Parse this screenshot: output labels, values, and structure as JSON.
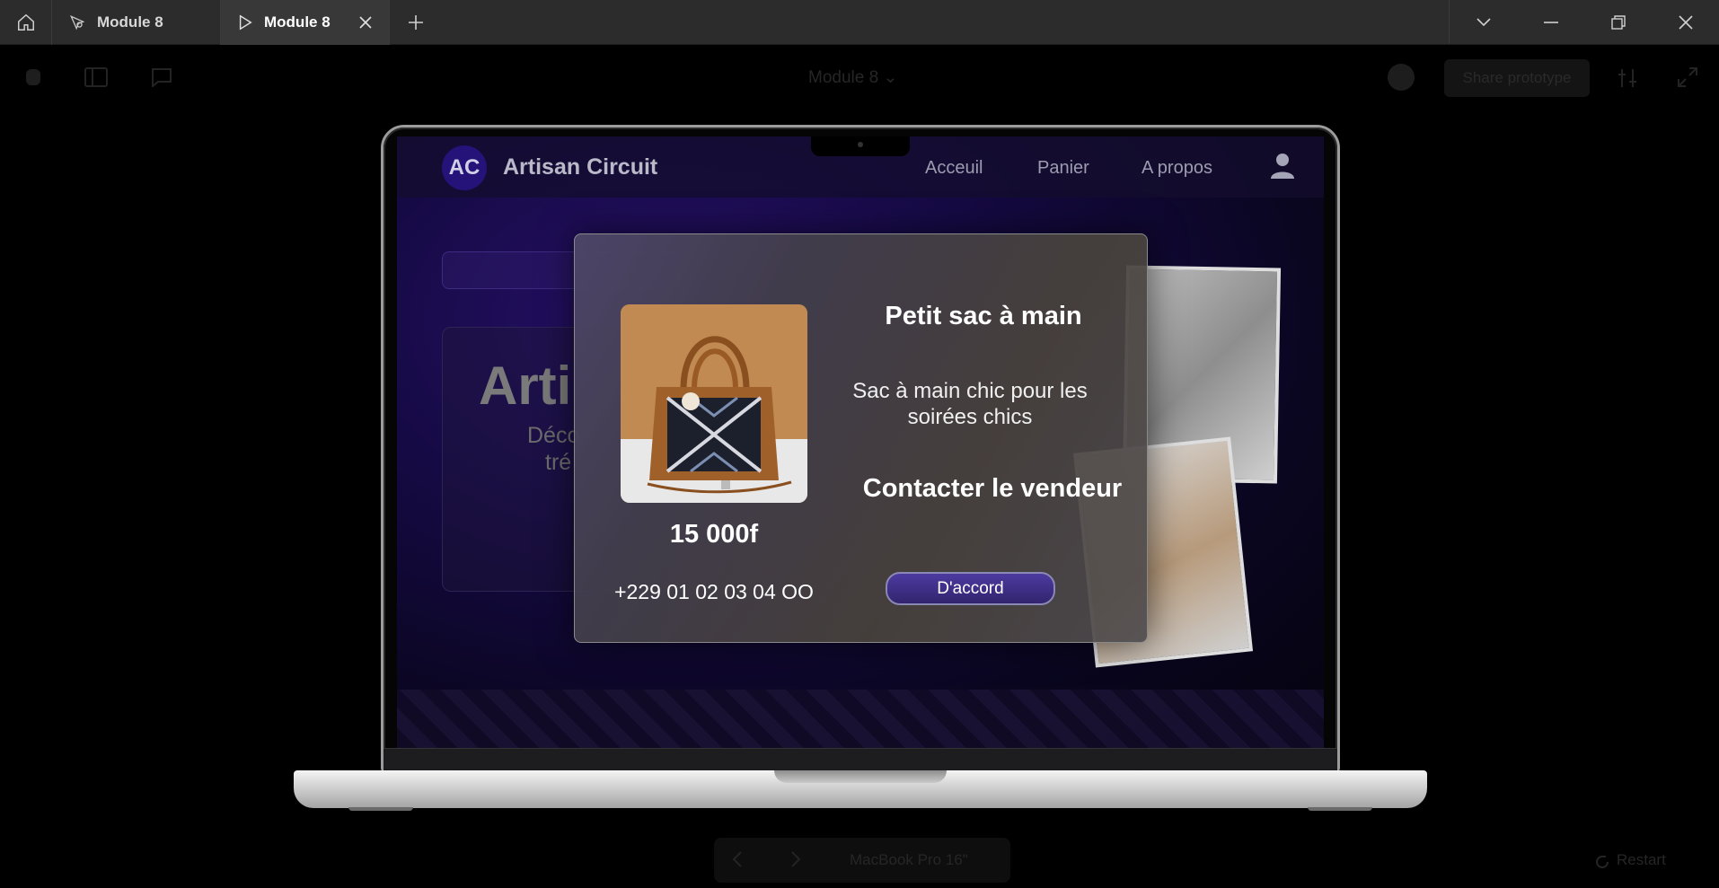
{
  "tabs": [
    {
      "label": "Module 8",
      "icon": "figma-icon",
      "active": false
    },
    {
      "label": "Module 8",
      "icon": "play-icon",
      "active": true
    }
  ],
  "toolbar": {
    "title": "Module 8",
    "share_label": "Share prototype"
  },
  "site": {
    "logo_text": "AC",
    "brand_name": "Artisan Circuit",
    "nav": [
      "Acceuil",
      "Panier",
      "A propos"
    ],
    "hero_title": "Arti",
    "hero_sub_line1": "Déco",
    "hero_sub_line2": "tré"
  },
  "modal": {
    "title": "Petit sac à main",
    "description": "Sac à main chic pour les soirées chics",
    "price": "15 000f",
    "contact_heading": "Contacter le vendeur",
    "phone": "+229 01 02 03 04 OO",
    "ok_label": "D'accord"
  },
  "bottom": {
    "device": "MacBook Pro 16\"",
    "restart": "Restart"
  },
  "colors": {
    "accent": "#4d3aa0",
    "site_bg": "#160a45",
    "tabbar": "#2c2c2c"
  }
}
